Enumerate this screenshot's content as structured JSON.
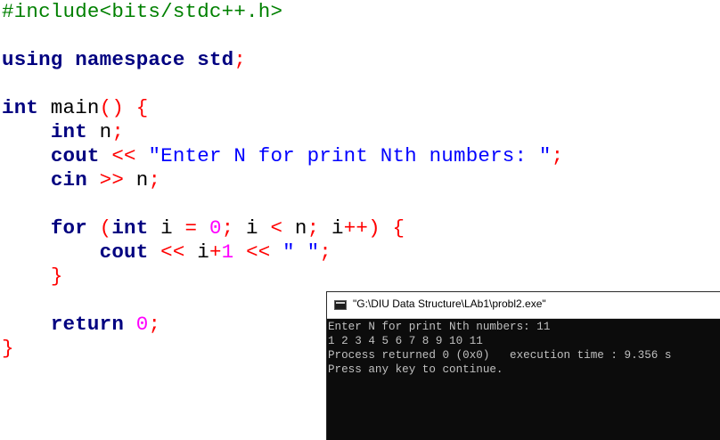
{
  "editor": {
    "colors": {
      "keyword": "#000080",
      "preprocessor": "#008000",
      "string": "#0000ff",
      "number": "#ff00ff",
      "operator": "#ff0000"
    },
    "lines": [
      {
        "tokens": [
          {
            "t": "pre",
            "v": "#include<bits/stdc++.h>"
          }
        ]
      },
      {
        "tokens": []
      },
      {
        "tokens": [
          {
            "t": "kw",
            "v": "using"
          },
          {
            "t": "id",
            "v": " "
          },
          {
            "t": "kw",
            "v": "namespace"
          },
          {
            "t": "id",
            "v": " "
          },
          {
            "t": "kw",
            "v": "std"
          },
          {
            "t": "op",
            "v": ";"
          }
        ]
      },
      {
        "tokens": []
      },
      {
        "tokens": [
          {
            "t": "kw",
            "v": "int"
          },
          {
            "t": "id",
            "v": " main"
          },
          {
            "t": "op",
            "v": "()"
          },
          {
            "t": "id",
            "v": " "
          },
          {
            "t": "op",
            "v": "{"
          }
        ]
      },
      {
        "tokens": [
          {
            "t": "id",
            "v": "    "
          },
          {
            "t": "kw",
            "v": "int"
          },
          {
            "t": "id",
            "v": " n"
          },
          {
            "t": "op",
            "v": ";"
          }
        ]
      },
      {
        "tokens": [
          {
            "t": "id",
            "v": "    "
          },
          {
            "t": "kw",
            "v": "cout"
          },
          {
            "t": "id",
            "v": " "
          },
          {
            "t": "op",
            "v": "<<"
          },
          {
            "t": "id",
            "v": " "
          },
          {
            "t": "str",
            "v": "\"Enter N for print Nth numbers: \""
          },
          {
            "t": "op",
            "v": ";"
          }
        ]
      },
      {
        "tokens": [
          {
            "t": "id",
            "v": "    "
          },
          {
            "t": "kw",
            "v": "cin"
          },
          {
            "t": "id",
            "v": " "
          },
          {
            "t": "op",
            "v": ">>"
          },
          {
            "t": "id",
            "v": " n"
          },
          {
            "t": "op",
            "v": ";"
          }
        ]
      },
      {
        "tokens": []
      },
      {
        "tokens": [
          {
            "t": "id",
            "v": "    "
          },
          {
            "t": "kw",
            "v": "for"
          },
          {
            "t": "id",
            "v": " "
          },
          {
            "t": "op",
            "v": "("
          },
          {
            "t": "kw",
            "v": "int"
          },
          {
            "t": "id",
            "v": " i "
          },
          {
            "t": "op",
            "v": "="
          },
          {
            "t": "id",
            "v": " "
          },
          {
            "t": "num",
            "v": "0"
          },
          {
            "t": "op",
            "v": ";"
          },
          {
            "t": "id",
            "v": " i "
          },
          {
            "t": "op",
            "v": "<"
          },
          {
            "t": "id",
            "v": " n"
          },
          {
            "t": "op",
            "v": ";"
          },
          {
            "t": "id",
            "v": " i"
          },
          {
            "t": "op",
            "v": "++)"
          },
          {
            "t": "id",
            "v": " "
          },
          {
            "t": "op",
            "v": "{"
          }
        ]
      },
      {
        "tokens": [
          {
            "t": "id",
            "v": "        "
          },
          {
            "t": "kw",
            "v": "cout"
          },
          {
            "t": "id",
            "v": " "
          },
          {
            "t": "op",
            "v": "<<"
          },
          {
            "t": "id",
            "v": " i"
          },
          {
            "t": "op",
            "v": "+"
          },
          {
            "t": "num",
            "v": "1"
          },
          {
            "t": "id",
            "v": " "
          },
          {
            "t": "op",
            "v": "<<"
          },
          {
            "t": "id",
            "v": " "
          },
          {
            "t": "str",
            "v": "\" \""
          },
          {
            "t": "op",
            "v": ";"
          }
        ]
      },
      {
        "tokens": [
          {
            "t": "id",
            "v": "    "
          },
          {
            "t": "op",
            "v": "}"
          }
        ]
      },
      {
        "tokens": []
      },
      {
        "tokens": [
          {
            "t": "id",
            "v": "    "
          },
          {
            "t": "kw",
            "v": "return"
          },
          {
            "t": "id",
            "v": " "
          },
          {
            "t": "num",
            "v": "0"
          },
          {
            "t": "op",
            "v": ";"
          }
        ]
      },
      {
        "tokens": [
          {
            "t": "op",
            "v": "}"
          }
        ]
      }
    ]
  },
  "console": {
    "title": "\"G:\\DIU Data Structure\\LAb1\\probl2.exe\"",
    "icon": "console-window-icon",
    "background": "#0c0c0c",
    "text_color": "#c0c0c0",
    "lines": [
      "Enter N for print Nth numbers: 11",
      "1 2 3 4 5 6 7 8 9 10 11",
      "Process returned 0 (0x0)   execution time : 9.356 s",
      "Press any key to continue."
    ]
  }
}
